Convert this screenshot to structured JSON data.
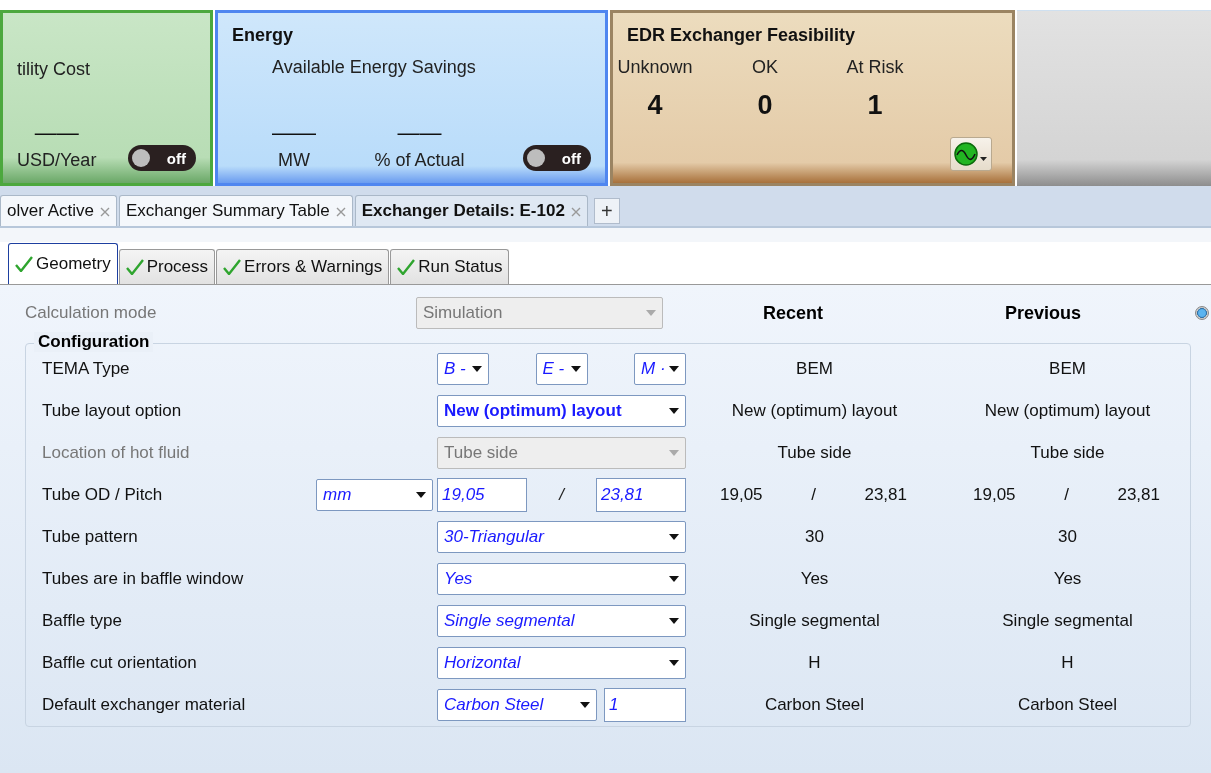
{
  "cards": [
    {
      "kind": "utility",
      "title": "tility Cost",
      "metrics": [
        {
          "value": "——",
          "unit": "USD/Year"
        }
      ],
      "toggle": {
        "on": false,
        "label": "off"
      }
    },
    {
      "kind": "energy",
      "title": "Energy",
      "subtitle": "Available Energy Savings",
      "metrics": [
        {
          "value": "——",
          "unit": "MW"
        },
        {
          "value": "——",
          "unit": "% of Actual"
        }
      ],
      "toggle": {
        "on": false,
        "label": "off"
      }
    },
    {
      "kind": "feasibility",
      "title": "EDR Exchanger Feasibility",
      "stats": [
        {
          "label": "Unknown",
          "value": "4"
        },
        {
          "label": "OK",
          "value": "0"
        },
        {
          "label": "At Risk",
          "value": "1"
        }
      ]
    }
  ],
  "doc_tabs": [
    {
      "label": "olver Active",
      "selected": false
    },
    {
      "label": "Exchanger Summary Table",
      "selected": false
    },
    {
      "label": "Exchanger Details: E-102",
      "selected": true
    }
  ],
  "add_tab": "+",
  "sub_tabs": [
    {
      "label": "Geometry",
      "selected": true
    },
    {
      "label": "Process",
      "selected": false
    },
    {
      "label": "Errors & Warnings",
      "selected": false
    },
    {
      "label": "Run Status",
      "selected": false
    }
  ],
  "calculation_mode": {
    "label": "Calculation mode",
    "value": "Simulation",
    "disabled": true
  },
  "columns": [
    "Recent",
    "Previous"
  ],
  "radio": {
    "selected": true
  },
  "group_title": "Configuration",
  "rows": [
    {
      "kind": "triple",
      "label": "TEMA Type",
      "disabled": false,
      "selects": [
        "B -",
        "E -",
        "M ·"
      ],
      "recent": [
        "BEM"
      ],
      "previous": [
        "BEM"
      ]
    },
    {
      "kind": "select",
      "label": "Tube layout option",
      "disabled": false,
      "emphasized": true,
      "value": "New (optimum) layout",
      "recent": [
        "New (optimum) layout"
      ],
      "previous": [
        "New (optimum) layout"
      ]
    },
    {
      "kind": "select",
      "label": "Location of hot fluid",
      "disabled": true,
      "emphasized": false,
      "value": "Tube side",
      "recent": [
        "Tube side"
      ],
      "previous": [
        "Tube side"
      ]
    },
    {
      "kind": "pair",
      "label": "Tube OD / Pitch",
      "disabled": false,
      "unit": "mm",
      "inputs": [
        "19,05",
        "23,81"
      ],
      "separator": "/",
      "recent": [
        "19,05",
        "/",
        "23,81"
      ],
      "previous": [
        "19,05",
        "/",
        "23,81"
      ]
    },
    {
      "kind": "select",
      "label": "Tube pattern",
      "disabled": false,
      "emphasized": false,
      "value": "30-Triangular",
      "recent": [
        "30"
      ],
      "previous": [
        "30"
      ]
    },
    {
      "kind": "select",
      "label": "Tubes are in baffle window",
      "disabled": false,
      "emphasized": false,
      "value": "Yes",
      "recent": [
        "Yes"
      ],
      "previous": [
        "Yes"
      ]
    },
    {
      "kind": "select",
      "label": "Baffle type",
      "disabled": false,
      "emphasized": false,
      "value": "Single segmental",
      "recent": [
        "Single segmental"
      ],
      "previous": [
        "Single segmental"
      ]
    },
    {
      "kind": "select",
      "label": "Baffle cut orientation",
      "disabled": false,
      "emphasized": false,
      "value": "Horizontal",
      "recent": [
        "H"
      ],
      "previous": [
        "H"
      ]
    },
    {
      "kind": "select-input",
      "label": "Default exchanger material",
      "disabled": false,
      "value": "Carbon Steel",
      "input": "1",
      "recent": [
        "Carbon Steel"
      ],
      "previous": [
        "Carbon Steel"
      ]
    }
  ]
}
